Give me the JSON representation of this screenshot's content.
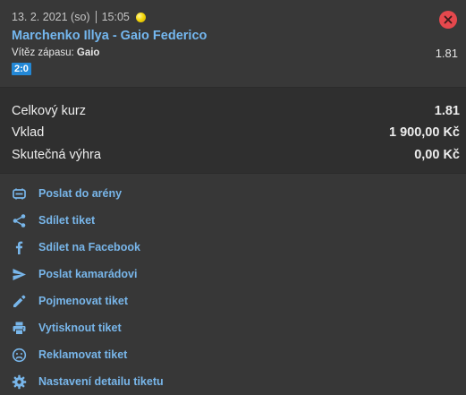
{
  "bet": {
    "date": "13. 2. 2021 (so)",
    "time": "15:05",
    "sport_icon": "tennis-ball-icon",
    "match_name": "Marchenko Illya - Gaio Federico",
    "market_label": "Vítěz zápasu:",
    "selection": "Gaio",
    "odd": "1.81",
    "score": "2:0"
  },
  "summary": {
    "total_odds_label": "Celkový kurz",
    "total_odds_value": "1.81",
    "stake_label": "Vklad",
    "stake_value": "1 900,00 Kč",
    "actual_win_label": "Skutečná výhra",
    "actual_win_value": "0,00 Kč"
  },
  "actions": [
    {
      "label": "Poslat do arény",
      "icon": "arena-icon"
    },
    {
      "label": "Sdílet tiket",
      "icon": "share-icon"
    },
    {
      "label": "Sdílet na Facebook",
      "icon": "facebook-icon"
    },
    {
      "label": "Poslat kamarádovi",
      "icon": "send-icon"
    },
    {
      "label": "Pojmenovat tiket",
      "icon": "pencil-icon"
    },
    {
      "label": "Vytisknout tiket",
      "icon": "print-icon"
    },
    {
      "label": "Reklamovat tiket",
      "icon": "sad-face-icon"
    },
    {
      "label": "Nastavení detailu tiketu",
      "icon": "gear-icon"
    }
  ],
  "colors": {
    "link": "#78b6ea",
    "match_name": "#74b7ef",
    "score_badge": "#2388d6",
    "remove_button": "#e5484d"
  }
}
